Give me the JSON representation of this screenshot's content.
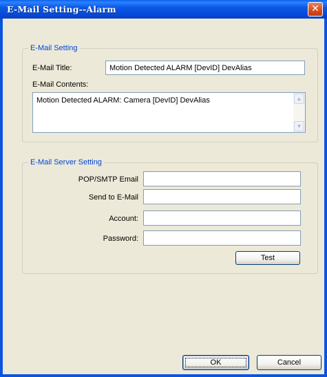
{
  "window": {
    "title": "E-Mail Setting--Alarm",
    "close_icon": "close-icon"
  },
  "email_setting": {
    "legend": "E-Mail Setting",
    "title_label": "E-Mail Title:",
    "title_value": "Motion Detected ALARM [DevID] DevAlias",
    "contents_label": "E-Mail Contents:",
    "contents_value": "Motion Detected ALARM: Camera [DevID] DevAlias"
  },
  "server_setting": {
    "legend": "E-Mail Server Setting",
    "pop_smtp_label": "POP/SMTP Email",
    "pop_smtp_value": "",
    "send_to_label": "Send to E-Mail",
    "send_to_value": "",
    "account_label": "Account:",
    "account_value": "",
    "password_label": "Password:",
    "password_value": "",
    "test_label": "Test"
  },
  "footer": {
    "ok_label": "OK",
    "cancel_label": "Cancel"
  }
}
